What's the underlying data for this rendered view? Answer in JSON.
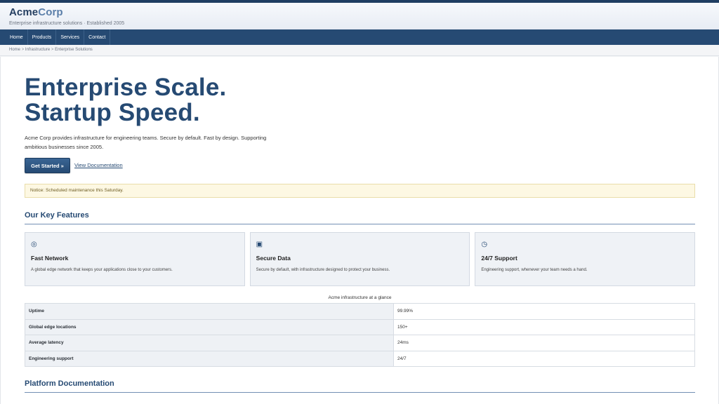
{
  "brand": {
    "name_a": "Acme",
    "name_b": "Corp",
    "tagline": "Enterprise infrastructure solutions · Established 2005"
  },
  "nav": {
    "items": [
      "Home",
      "Products",
      "Services",
      "Contact"
    ]
  },
  "breadcrumb": {
    "items": [
      "Home",
      "Infrastructure",
      "Enterprise Solutions"
    ],
    "separator": ">"
  },
  "hero": {
    "title_line1": "Enterprise Scale.",
    "title_line2": "Startup Speed.",
    "description": "Acme Corp provides infrastructure for engineering teams. Secure by default. Fast by design. Supporting ambitious businesses since 2005.",
    "cta_primary": "Get Started »",
    "cta_secondary": "View Documentation"
  },
  "notice": "Notice: Scheduled maintenance this Saturday.",
  "features": {
    "heading": "Our Key Features",
    "items": [
      {
        "icon": "target-icon",
        "glyph": "◎",
        "title": "Fast Network",
        "description": "A global edge network that keeps your applications close to your customers."
      },
      {
        "icon": "square-icon",
        "glyph": "▣",
        "title": "Secure Data",
        "description": "Secure by default, with infrastructure designed to protect your business."
      },
      {
        "icon": "clock-icon",
        "glyph": "◷",
        "title": "24/7 Support",
        "description": "Engineering support, whenever your team needs a hand."
      }
    ]
  },
  "stats": {
    "caption": "Acme infrastructure at a glance",
    "rows": [
      {
        "label": "Uptime",
        "value": "99.99%"
      },
      {
        "label": "Global edge locations",
        "value": "150+"
      },
      {
        "label": "Average latency",
        "value": "24ms"
      },
      {
        "label": "Engineering support",
        "value": "24/7"
      }
    ]
  },
  "docs": {
    "heading": "Platform Documentation"
  },
  "colors": {
    "primary": "#264a73",
    "accent": "#5a7ea9",
    "notice_bg": "#fdf8e3"
  }
}
